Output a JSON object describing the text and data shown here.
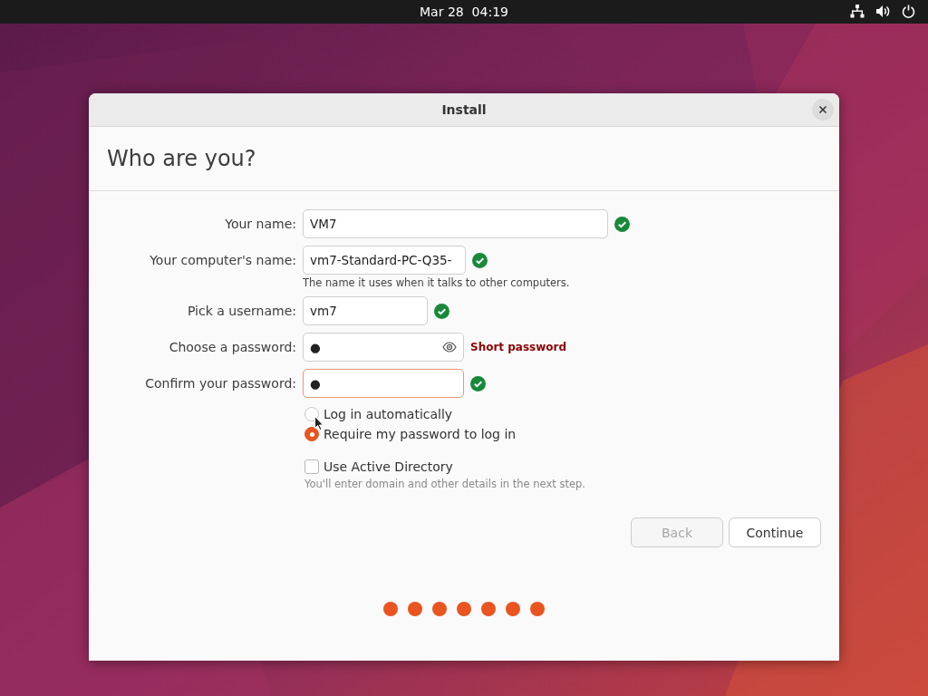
{
  "top_bar": {
    "clock": "Mar 28  04:19"
  },
  "window": {
    "title": "Install",
    "heading": "Who are you?"
  },
  "fields": [
    {
      "label": "Your name:",
      "value": "VM7",
      "valid": true,
      "focused": false
    },
    {
      "label": "Your computer's name:",
      "value": "vm7-Standard-PC-Q35-",
      "valid": true,
      "focused": false,
      "hint": "The name it uses when it talks to other computers."
    },
    {
      "label": "Pick a username:",
      "value": "vm7",
      "valid": true,
      "focused": false
    },
    {
      "label": "Choose a password:",
      "value": "●",
      "focused": false,
      "reveal": true,
      "error": "Short password"
    },
    {
      "label": "Confirm your password:",
      "value": "●",
      "valid": true,
      "focused": true
    }
  ],
  "login_options": [
    {
      "label": "Log in automatically",
      "selected": false
    },
    {
      "label": "Require my password to log in",
      "selected": true
    }
  ],
  "active_directory": {
    "label": "Use Active Directory",
    "checked": false,
    "hint": "You'll enter domain and other details in the next step."
  },
  "buttons": [
    {
      "label": "Back",
      "disabled": true
    },
    {
      "label": "Continue",
      "disabled": false
    }
  ],
  "progress": [
    {
      "done": true
    },
    {
      "done": true
    },
    {
      "done": true
    },
    {
      "done": true
    },
    {
      "done": true
    },
    {
      "done": true
    },
    {
      "done": true
    }
  ]
}
